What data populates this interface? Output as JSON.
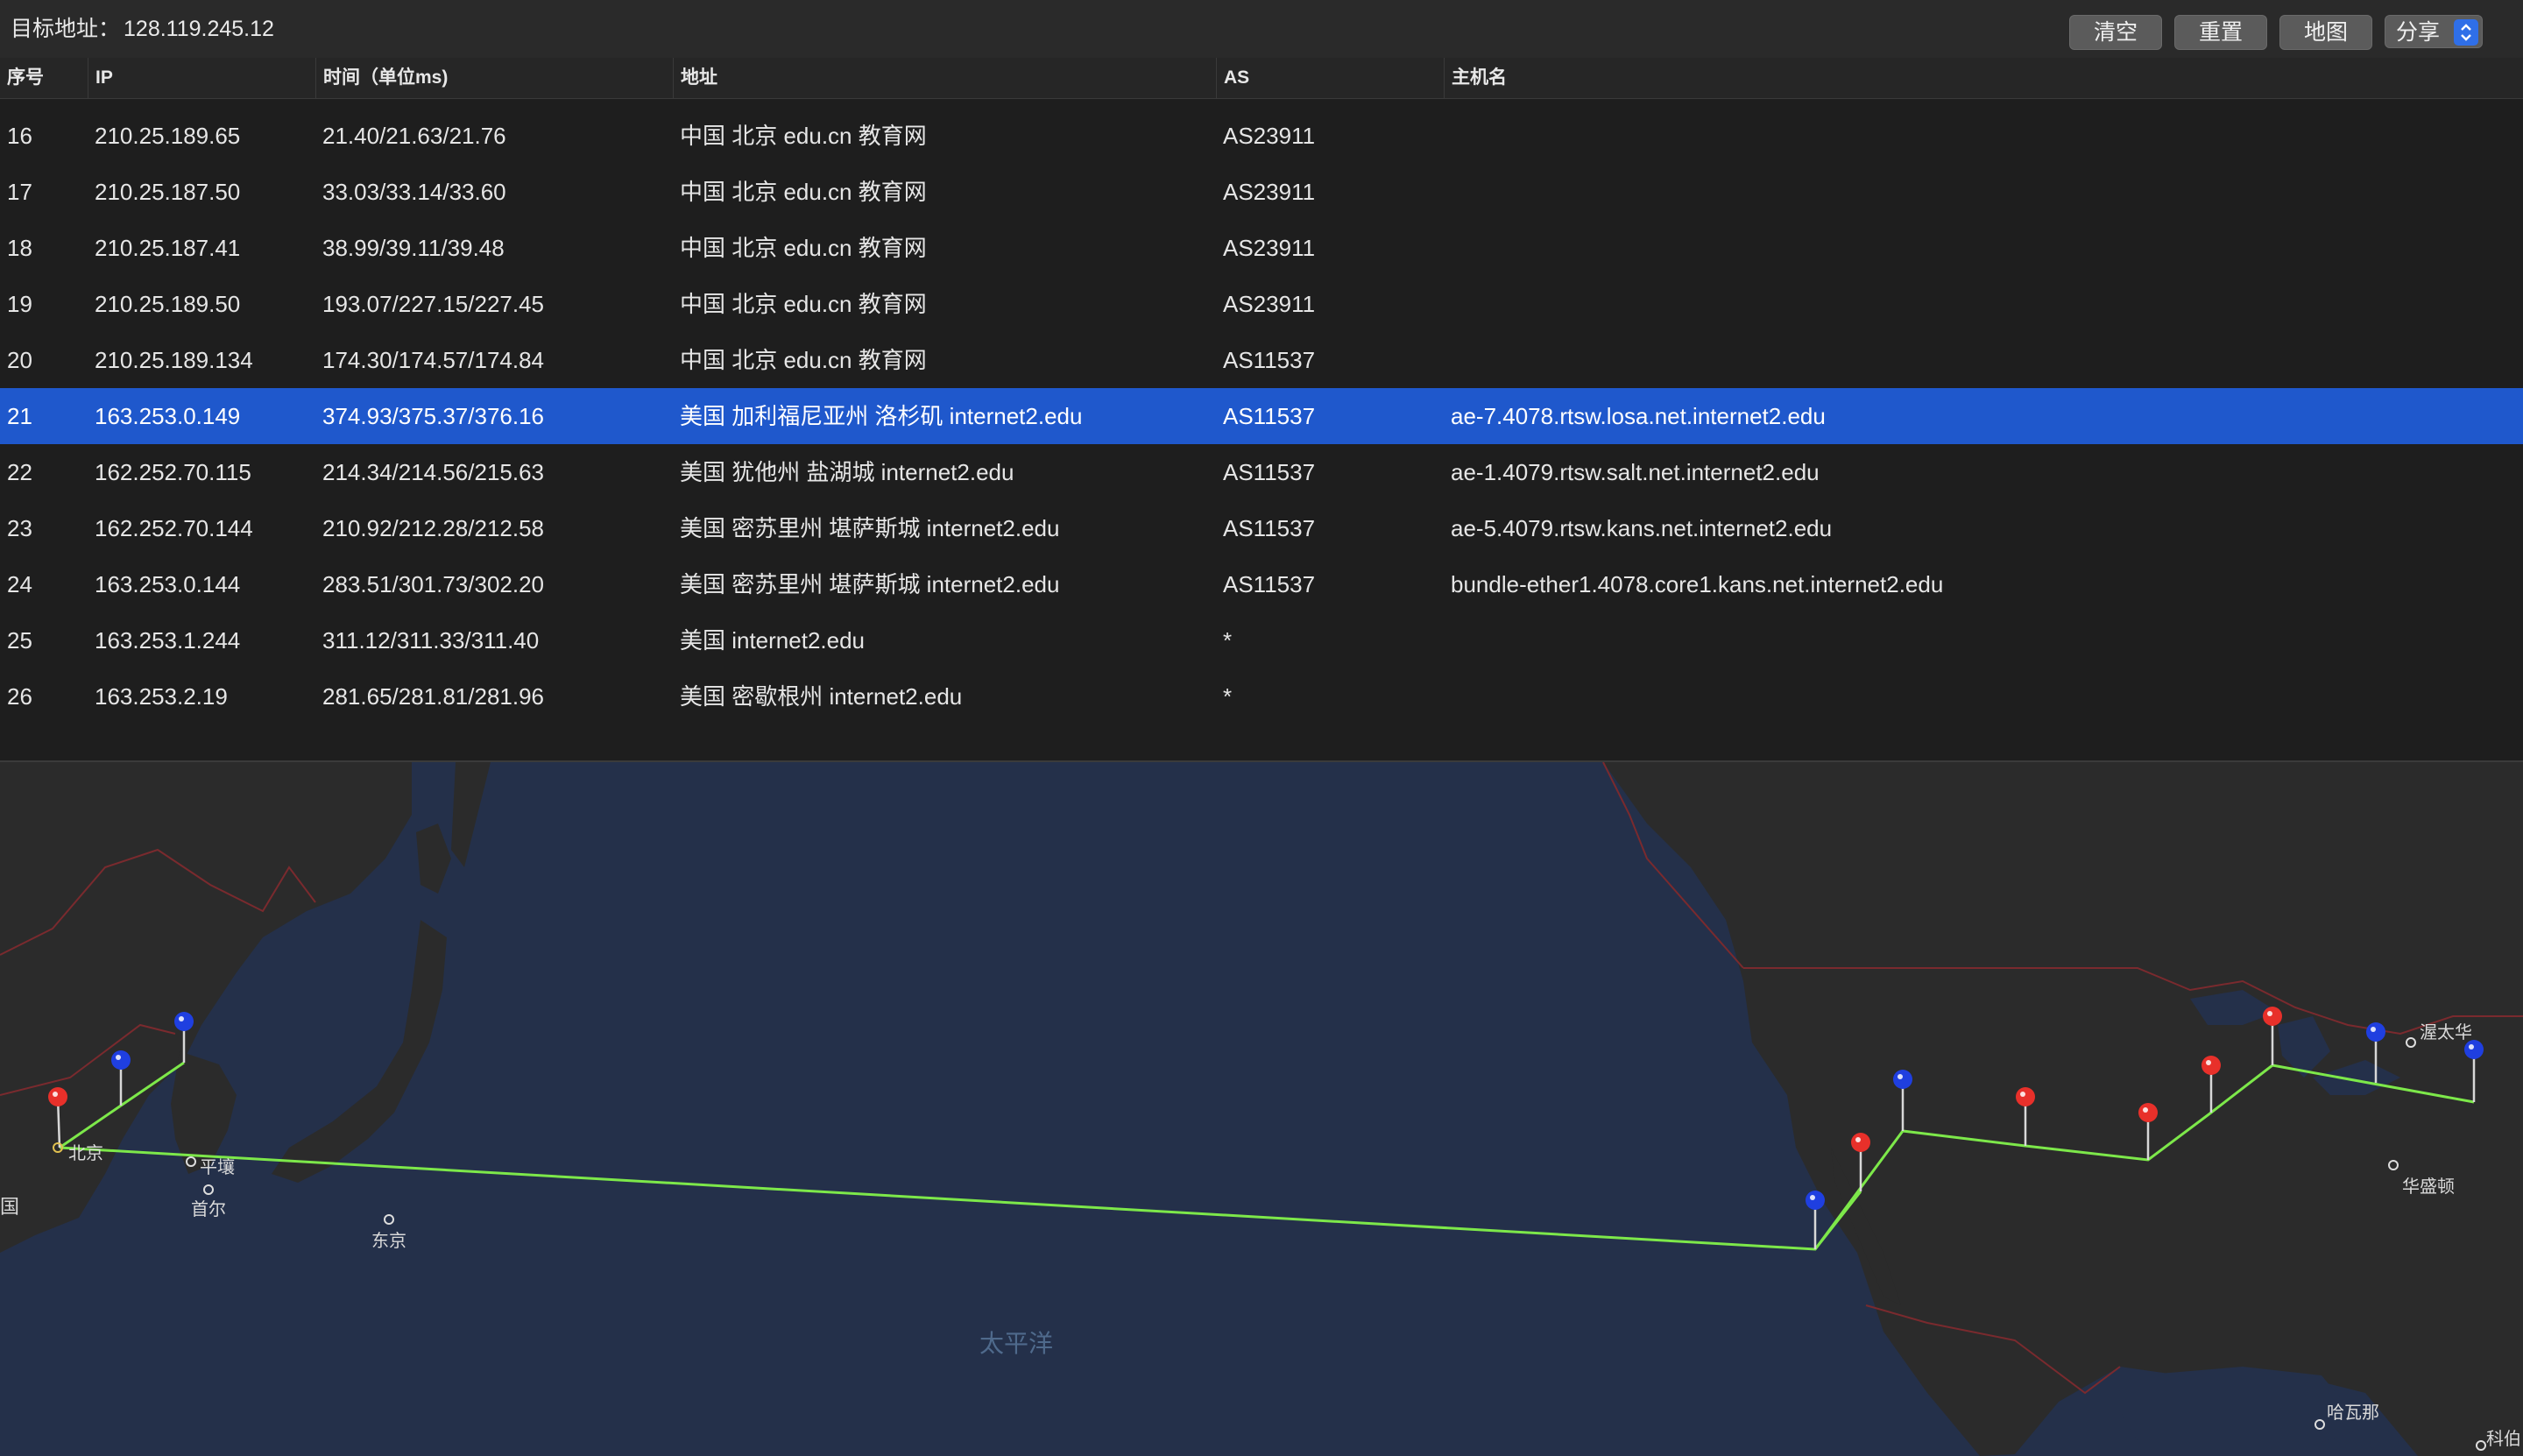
{
  "toolbar": {
    "target_label": "目标地址：",
    "target_value": "128.119.245.12",
    "clear_label": "清空",
    "reset_label": "重置",
    "map_label": "地图",
    "share_label": "分享"
  },
  "table": {
    "headers": [
      "序号",
      "IP",
      "时间（单位ms)",
      "地址",
      "AS",
      "主机名"
    ],
    "rows": [
      {
        "no": "16",
        "ip": "210.25.189.65",
        "time": "21.40/21.63/21.76",
        "addr": "中国 北京 edu.cn 教育网",
        "as": "AS23911",
        "host": ""
      },
      {
        "no": "17",
        "ip": "210.25.187.50",
        "time": "33.03/33.14/33.60",
        "addr": "中国 北京 edu.cn 教育网",
        "as": "AS23911",
        "host": ""
      },
      {
        "no": "18",
        "ip": "210.25.187.41",
        "time": "38.99/39.11/39.48",
        "addr": "中国 北京 edu.cn 教育网",
        "as": "AS23911",
        "host": ""
      },
      {
        "no": "19",
        "ip": "210.25.189.50",
        "time": "193.07/227.15/227.45",
        "addr": "中国 北京 edu.cn 教育网",
        "as": "AS23911",
        "host": ""
      },
      {
        "no": "20",
        "ip": "210.25.189.134",
        "time": "174.30/174.57/174.84",
        "addr": "中国 北京 edu.cn 教育网",
        "as": "AS11537",
        "host": ""
      },
      {
        "no": "21",
        "ip": "163.253.0.149",
        "time": "374.93/375.37/376.16",
        "addr": "美国 加利福尼亚州 洛杉矶 internet2.edu",
        "as": "AS11537",
        "host": "ae-7.4078.rtsw.losa.net.internet2.edu"
      },
      {
        "no": "22",
        "ip": "162.252.70.115",
        "time": "214.34/214.56/215.63",
        "addr": "美国 犹他州 盐湖城 internet2.edu",
        "as": "AS11537",
        "host": "ae-1.4079.rtsw.salt.net.internet2.edu"
      },
      {
        "no": "23",
        "ip": "162.252.70.144",
        "time": "210.92/212.28/212.58",
        "addr": "美国 密苏里州 堪萨斯城 internet2.edu",
        "as": "AS11537",
        "host": "ae-5.4079.rtsw.kans.net.internet2.edu"
      },
      {
        "no": "24",
        "ip": "163.253.0.144",
        "time": "283.51/301.73/302.20",
        "addr": "美国 密苏里州 堪萨斯城 internet2.edu",
        "as": "AS11537",
        "host": "bundle-ether1.4078.core1.kans.net.internet2.edu"
      },
      {
        "no": "25",
        "ip": "163.253.1.244",
        "time": "311.12/311.33/311.40",
        "addr": "美国 internet2.edu",
        "as": "*",
        "host": ""
      },
      {
        "no": "26",
        "ip": "163.253.2.19",
        "time": "281.65/281.81/281.96",
        "addr": "美国 密歇根州 internet2.edu",
        "as": "*",
        "host": ""
      }
    ],
    "selected_no": "21"
  },
  "map": {
    "labels": {
      "beijing": "北京",
      "pyongyang": "平壤",
      "seoul": "首尔",
      "tokyo": "东京",
      "pacific": "太平洋",
      "ottawa": "渥太华",
      "washington": "华盛顿",
      "havana": "哈瓦那",
      "china_partial": "国",
      "cologne_partial": "科伯"
    },
    "colors": {
      "route": "#7de84a",
      "pin_red": "#e8302a",
      "pin_blue": "#1f3fe0",
      "ocean": "#24304a",
      "land": "#2b2b2b",
      "border": "#7a2a2e"
    }
  }
}
